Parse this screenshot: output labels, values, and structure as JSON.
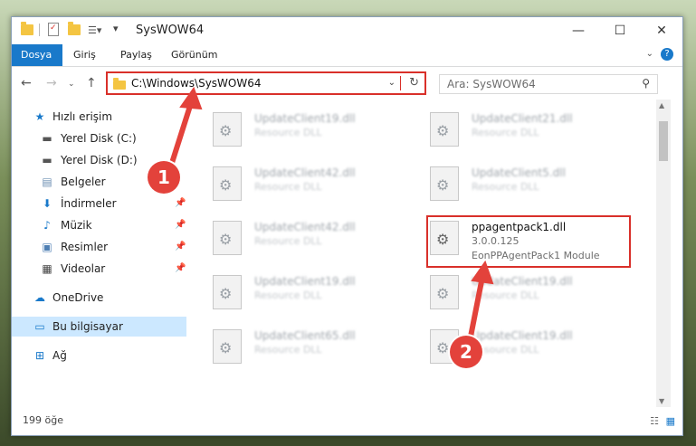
{
  "window": {
    "title": "SysWOW64",
    "controls": {
      "minimize": "—",
      "maximize": "☐",
      "close": "✕"
    }
  },
  "ribbon": {
    "tabs": [
      {
        "label": "Dosya",
        "active": true
      },
      {
        "label": "Giriş",
        "active": false
      },
      {
        "label": "Paylaş",
        "active": false
      },
      {
        "label": "Görünüm",
        "active": false
      }
    ],
    "help": "?"
  },
  "address": {
    "path": "C:\\Windows\\SysWOW64",
    "search_placeholder": "Ara: SysWOW64"
  },
  "sidebar": {
    "items": [
      {
        "label": "Hızlı erişim",
        "icon": "star-icon",
        "pinned": false
      },
      {
        "label": "Yerel Disk (C:)",
        "icon": "drive-icon",
        "pinned": false
      },
      {
        "label": "Yerel Disk (D:)",
        "icon": "drive-icon",
        "pinned": false
      },
      {
        "label": "Belgeler",
        "icon": "document-icon",
        "pinned": true
      },
      {
        "label": "İndirmeler",
        "icon": "download-icon",
        "pinned": true
      },
      {
        "label": "Müzik",
        "icon": "music-icon",
        "pinned": true
      },
      {
        "label": "Resimler",
        "icon": "image-icon",
        "pinned": true
      },
      {
        "label": "Videolar",
        "icon": "video-icon",
        "pinned": true
      },
      {
        "label": "OneDrive",
        "icon": "cloud-icon",
        "pinned": false
      },
      {
        "label": "Bu bilgisayar",
        "icon": "computer-icon",
        "pinned": false,
        "selected": true
      },
      {
        "label": "Ağ",
        "icon": "network-icon",
        "pinned": false
      }
    ]
  },
  "files": [
    {
      "name": "UpdateClient19.dll",
      "type": "Resource DLL"
    },
    {
      "name": "UpdateClient21.dll",
      "type": "Resource DLL"
    },
    {
      "name": "UpdateClient42.dll",
      "type": "Resource DLL"
    },
    {
      "name": "UpdateClient5.dll",
      "type": "Resource DLL"
    },
    {
      "name": "UpdateClient42.dll",
      "type": "Resource DLL"
    },
    {
      "name": "ppagentpack1.dll",
      "version": "3.0.0.125",
      "type": "EonPPAgentPack1 Module",
      "highlighted": true
    },
    {
      "name": "UpdateClient19.dll",
      "type": "Resource DLL"
    },
    {
      "name": "UpdateClient19.dll",
      "type": "Resource DLL"
    },
    {
      "name": "UpdateClient65.dll",
      "type": "Resource DLL"
    },
    {
      "name": "UpdateClient19.dll",
      "type": "Resource DLL"
    }
  ],
  "status": {
    "item_count": "199 öğe"
  },
  "annotations": {
    "badge1": "1",
    "badge2": "2",
    "color": "#e3423b"
  }
}
